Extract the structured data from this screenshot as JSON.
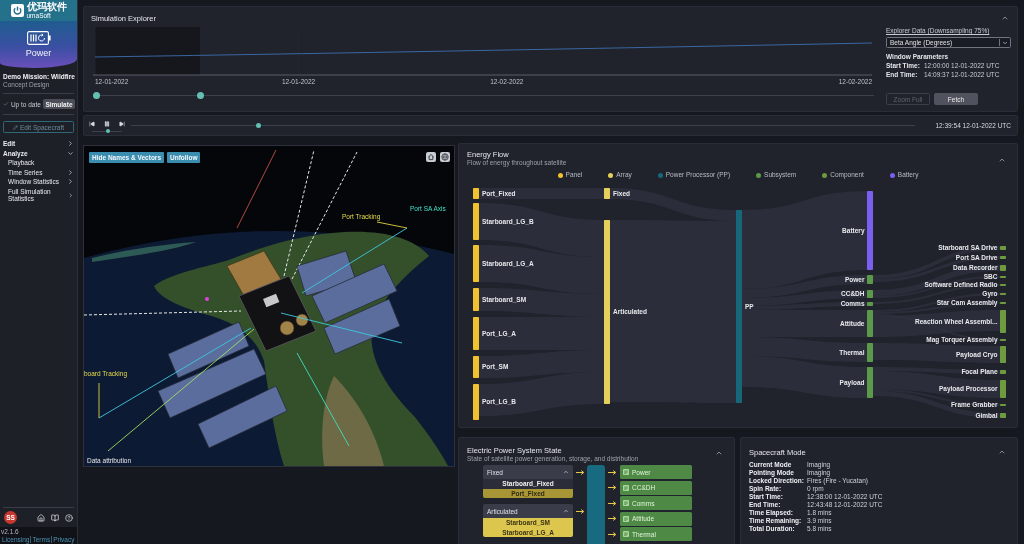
{
  "sidebar": {
    "logo": {
      "name": "优玛软件",
      "subtitle": "umaSoft"
    },
    "module": "Power",
    "mission": {
      "title": "Demo Mission: Wildfire",
      "subtitle": "Concept Design"
    },
    "status": {
      "label": "Up to date"
    },
    "simulate_button": "Simulate",
    "edit_button": {
      "label": "Edit Spacecraft",
      "disabled": true
    },
    "nav": [
      {
        "label": "Edit",
        "expanded": false
      },
      {
        "label": "Analyze",
        "expanded": true,
        "children": [
          {
            "label": "Playback"
          },
          {
            "label": "Time Series",
            "expanded": false
          },
          {
            "label": "Window Statistics",
            "expanded": false
          },
          {
            "label": "Full Simulation Statistics",
            "expanded": false
          }
        ]
      }
    ],
    "avatar": "SS",
    "version": "v2.1.6",
    "footer_links": [
      "Licensing",
      "Terms",
      "Privacy"
    ]
  },
  "explorer": {
    "title": "Simulation Explorer",
    "expanded": true,
    "x_labels": [
      "12-01-2022",
      "12-01-2022",
      "12-02-2022",
      "12-02-2022"
    ],
    "window": {
      "start": {
        "level": 0
      },
      "end": {
        "level": 0.135
      }
    },
    "data_label": "Explorer Data (Downsampling 75%)",
    "data_select": "Beta Angle (Degrees)",
    "params_title": "Window Parameters",
    "params": [
      {
        "label": "Start Time:",
        "value": "12:00:00 12-01-2022 UTC"
      },
      {
        "label": "End Time:",
        "value": "14:09:37 12-01-2022 UTC"
      }
    ],
    "buttons": [
      {
        "label": "Zoom Full",
        "disabled": true
      },
      {
        "label": "Fetch",
        "disabled": false
      }
    ]
  },
  "playback": {
    "playing": true,
    "speed": {
      "level": 0.55
    },
    "position": {
      "level": 0.16
    },
    "time": "12:39:54 12-01-2022 UTC"
  },
  "viewport": {
    "buttons": [
      "Hide Names & Vectors",
      "Unfollow"
    ],
    "labels": [
      {
        "text": "Port Tracking",
        "kind": "tracking"
      },
      {
        "text": "Port SA Axis",
        "kind": "axis"
      },
      {
        "text": "board Tracking",
        "kind": "tracking"
      }
    ],
    "credit": "Data attribution"
  },
  "energy_flow": {
    "title": "Energy Flow",
    "subtitle": "Flow of energy throughout satellite",
    "expanded": true,
    "legend": [
      {
        "kind": "panel",
        "label": "Panel",
        "color": "#f2c12e"
      },
      {
        "kind": "array",
        "label": "Array",
        "color": "#e6d05c"
      },
      {
        "kind": "processor",
        "label": "Power Processor (PP)",
        "color": "#17677b"
      },
      {
        "kind": "subsystem",
        "label": "Subsystem",
        "color": "#5b9a49"
      },
      {
        "kind": "component",
        "label": "Component",
        "color": "#6f9b3f"
      },
      {
        "kind": "battery",
        "label": "Battery",
        "color": "#7a5ff0"
      }
    ],
    "columns": [
      {
        "nodes": [
          {
            "label": "Port_Fixed",
            "kind": "panel"
          },
          {
            "label": "Starboard_LG_B",
            "kind": "panel"
          },
          {
            "label": "Starboard_LG_A",
            "kind": "panel"
          },
          {
            "label": "Starboard_SM",
            "kind": "panel"
          },
          {
            "label": "Port_LG_A",
            "kind": "panel"
          },
          {
            "label": "Port_SM",
            "kind": "panel"
          },
          {
            "label": "Port_LG_B",
            "kind": "panel"
          }
        ]
      },
      {
        "nodes": [
          {
            "label": "Fixed",
            "kind": "array"
          },
          {
            "label": "Articulated",
            "kind": "array"
          }
        ]
      },
      {
        "nodes": [
          {
            "label": "PP",
            "kind": "processor"
          }
        ]
      },
      {
        "nodes": [
          {
            "label": "Battery",
            "kind": "battery"
          },
          {
            "label": "Power",
            "kind": "subsystem"
          },
          {
            "label": "CC&DH",
            "kind": "subsystem"
          },
          {
            "label": "Comms",
            "kind": "subsystem"
          },
          {
            "label": "Attitude",
            "kind": "subsystem"
          },
          {
            "label": "Thermal",
            "kind": "subsystem"
          },
          {
            "label": "Payload",
            "kind": "subsystem"
          }
        ]
      },
      {
        "nodes": [
          {
            "label": "Starboard SA Drive",
            "kind": "component"
          },
          {
            "label": "Port SA Drive",
            "kind": "component"
          },
          {
            "label": "Data Recorder",
            "kind": "component"
          },
          {
            "label": "SBC",
            "kind": "component"
          },
          {
            "label": "Software Defined Radio",
            "kind": "component"
          },
          {
            "label": "Gyro",
            "kind": "component"
          },
          {
            "label": "Star Cam Assembly",
            "kind": "component"
          },
          {
            "label": "Reaction Wheel Assembl...",
            "kind": "component"
          },
          {
            "label": "Mag Torquer Assembly",
            "kind": "component"
          },
          {
            "label": "Payload Cryo",
            "kind": "component"
          },
          {
            "label": "Focal Plane",
            "kind": "component"
          },
          {
            "label": "Payload Processor",
            "kind": "component"
          },
          {
            "label": "Frame Grabber",
            "kind": "component"
          },
          {
            "label": "Gimbal",
            "kind": "component"
          }
        ]
      }
    ]
  },
  "eps": {
    "title": "Electric Power System State",
    "subtitle": "State of satellite power generation, storage, and distribution",
    "expanded": true,
    "arrays": [
      {
        "label": "Fixed",
        "expanded": true,
        "panels": [
          {
            "label": "Starboard_Fixed",
            "kind": "shaded"
          },
          {
            "label": "Port_Fixed",
            "kind": "partial"
          }
        ]
      },
      {
        "label": "Articulated",
        "expanded": true,
        "panels": [
          {
            "label": "Starboard_SM",
            "kind": "lit"
          },
          {
            "label": "Starboard_LG_A",
            "kind": "lit"
          }
        ]
      }
    ],
    "subsystems": [
      "Power",
      "CC&DH",
      "Comms",
      "Attitude",
      "Thermal"
    ]
  },
  "spacecraft_mode": {
    "title": "Spacecraft Mode",
    "expanded": true,
    "rows": [
      {
        "label": "Current Mode",
        "value": "Imaging"
      },
      {
        "label": "Pointing Mode",
        "value": "Imaging"
      },
      {
        "label": "Locked Direction:",
        "value": "Fires (Fire - Yucatan)"
      },
      {
        "label": "Spin Rate:",
        "value": "0 rpm"
      },
      {
        "label": "Start Time:",
        "value": "12:38:00 12-01-2022 UTC"
      },
      {
        "label": "End Time:",
        "value": "12:43:48 12-01-2022 UTC"
      },
      {
        "label": "Time Elapsed:",
        "value": "1.8 mins"
      },
      {
        "label": "Time Remaining:",
        "value": "3.9 mins"
      },
      {
        "label": "Total Duration:",
        "value": "5.8 mins"
      }
    ]
  }
}
